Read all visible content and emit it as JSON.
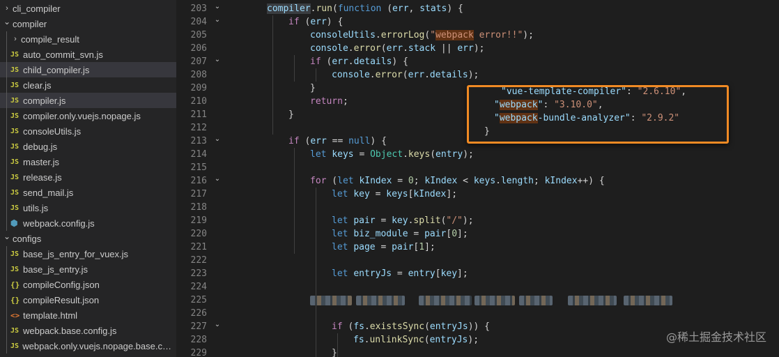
{
  "explorer": {
    "items": [
      {
        "label": "cli_compiler",
        "type": "folder",
        "level": 0,
        "expanded": false
      },
      {
        "label": "compiler",
        "type": "folder",
        "level": 0,
        "expanded": true
      },
      {
        "label": "compile_result",
        "type": "folder",
        "level": 1,
        "expanded": false
      },
      {
        "label": "auto_commit_svn.js",
        "type": "js",
        "level": 1
      },
      {
        "label": "child_compiler.js",
        "type": "js",
        "level": 1,
        "selected": true
      },
      {
        "label": "clear.js",
        "type": "js",
        "level": 1
      },
      {
        "label": "compiler.js",
        "type": "js",
        "level": 1,
        "hover": true
      },
      {
        "label": "compiler.only.vuejs.nopage.js",
        "type": "js",
        "level": 1
      },
      {
        "label": "consoleUtils.js",
        "type": "js",
        "level": 1
      },
      {
        "label": "debug.js",
        "type": "js",
        "level": 1
      },
      {
        "label": "master.js",
        "type": "js",
        "level": 1
      },
      {
        "label": "release.js",
        "type": "js",
        "level": 1
      },
      {
        "label": "send_mail.js",
        "type": "js",
        "level": 1
      },
      {
        "label": "utils.js",
        "type": "js",
        "level": 1
      },
      {
        "label": "webpack.config.js",
        "type": "webpack",
        "level": 1
      },
      {
        "label": "configs",
        "type": "folder",
        "level": 0,
        "expanded": true
      },
      {
        "label": "base_js_entry_for_vuex.js",
        "type": "js",
        "level": 1
      },
      {
        "label": "base_js_entry.js",
        "type": "js",
        "level": 1
      },
      {
        "label": "compileConfig.json",
        "type": "json",
        "level": 1
      },
      {
        "label": "compileResult.json",
        "type": "json",
        "level": 1
      },
      {
        "label": "template.html",
        "type": "html",
        "level": 1
      },
      {
        "label": "webpack.base.config.js",
        "type": "js",
        "level": 1
      },
      {
        "label": "webpack.only.vuejs.nopage.base.conf...",
        "type": "js",
        "level": 1
      }
    ],
    "icons": {
      "js": "JS",
      "json": "{}",
      "html": "<>",
      "webpack": "⬢",
      "folder_collapsed": "›",
      "folder_expanded": "⌄"
    }
  },
  "editor": {
    "lines": [
      {
        "n": "203",
        "fold": true,
        "indent": 2,
        "tokens": [
          [
            "compiler",
            "fnvarhl"
          ],
          [
            ".",
            ""
          ],
          [
            "run",
            "fn"
          ],
          [
            "(",
            ""
          ],
          [
            "function",
            "kw"
          ],
          [
            " (",
            ""
          ],
          [
            "err",
            "var"
          ],
          [
            ", ",
            ""
          ],
          [
            "stats",
            "var"
          ],
          [
            ") {",
            ""
          ]
        ]
      },
      {
        "n": "204",
        "fold": true,
        "indent": 3,
        "tokens": [
          [
            "if",
            "ctl"
          ],
          [
            " (",
            ""
          ],
          [
            "err",
            "var"
          ],
          [
            ") {",
            ""
          ]
        ]
      },
      {
        "n": "205",
        "fold": false,
        "indent": 4,
        "tokens": [
          [
            "consoleUtils",
            "var"
          ],
          [
            ".",
            ""
          ],
          [
            "errorLog",
            "fn"
          ],
          [
            "(",
            ""
          ],
          [
            "\"",
            "str"
          ],
          [
            "webpack",
            "strhl"
          ],
          [
            " error!!\"",
            "str"
          ],
          [
            ");",
            ""
          ]
        ]
      },
      {
        "n": "206",
        "fold": false,
        "indent": 4,
        "tokens": [
          [
            "console",
            "var"
          ],
          [
            ".",
            ""
          ],
          [
            "error",
            "fn"
          ],
          [
            "(",
            ""
          ],
          [
            "err",
            "var"
          ],
          [
            ".",
            ""
          ],
          [
            "stack",
            "var"
          ],
          [
            " || ",
            ""
          ],
          [
            "err",
            "var"
          ],
          [
            ");",
            ""
          ]
        ]
      },
      {
        "n": "207",
        "fold": true,
        "indent": 4,
        "tokens": [
          [
            "if",
            "ctl"
          ],
          [
            " (",
            ""
          ],
          [
            "err",
            "var"
          ],
          [
            ".",
            ""
          ],
          [
            "details",
            "var"
          ],
          [
            ") {",
            ""
          ]
        ]
      },
      {
        "n": "208",
        "fold": false,
        "indent": 5,
        "tokens": [
          [
            "console",
            "var"
          ],
          [
            ".",
            ""
          ],
          [
            "error",
            "fn"
          ],
          [
            "(",
            ""
          ],
          [
            "err",
            "var"
          ],
          [
            ".",
            ""
          ],
          [
            "details",
            "var"
          ],
          [
            ");",
            ""
          ]
        ]
      },
      {
        "n": "209",
        "fold": false,
        "indent": 4,
        "tokens": [
          [
            "}",
            ""
          ]
        ]
      },
      {
        "n": "210",
        "fold": false,
        "indent": 4,
        "tokens": [
          [
            "return",
            "ctl"
          ],
          [
            ";",
            ""
          ]
        ]
      },
      {
        "n": "211",
        "fold": false,
        "indent": 3,
        "tokens": [
          [
            "}",
            ""
          ]
        ]
      },
      {
        "n": "212",
        "fold": false,
        "indent": 0,
        "tokens": []
      },
      {
        "n": "213",
        "fold": true,
        "indent": 3,
        "tokens": [
          [
            "if",
            "ctl"
          ],
          [
            " (",
            ""
          ],
          [
            "err",
            "var"
          ],
          [
            " == ",
            ""
          ],
          [
            "null",
            "kw"
          ],
          [
            ") {",
            ""
          ]
        ]
      },
      {
        "n": "214",
        "fold": false,
        "indent": 4,
        "tokens": [
          [
            "let",
            "kw"
          ],
          [
            " ",
            ""
          ],
          [
            "keys",
            "var"
          ],
          [
            " = ",
            ""
          ],
          [
            "Object",
            "cls"
          ],
          [
            ".",
            ""
          ],
          [
            "keys",
            "fn"
          ],
          [
            "(",
            ""
          ],
          [
            "entry",
            "var"
          ],
          [
            ");",
            ""
          ]
        ]
      },
      {
        "n": "215",
        "fold": false,
        "indent": 0,
        "tokens": []
      },
      {
        "n": "216",
        "fold": true,
        "indent": 4,
        "tokens": [
          [
            "for",
            "ctl"
          ],
          [
            " (",
            ""
          ],
          [
            "let",
            "kw"
          ],
          [
            " ",
            ""
          ],
          [
            "kIndex",
            "var"
          ],
          [
            " = ",
            ""
          ],
          [
            "0",
            "num"
          ],
          [
            "; ",
            ""
          ],
          [
            "kIndex",
            "var"
          ],
          [
            " < ",
            ""
          ],
          [
            "keys",
            "var"
          ],
          [
            ".",
            ""
          ],
          [
            "length",
            "var"
          ],
          [
            "; ",
            ""
          ],
          [
            "kIndex",
            "var"
          ],
          [
            "++) {",
            ""
          ]
        ]
      },
      {
        "n": "217",
        "fold": false,
        "indent": 5,
        "tokens": [
          [
            "let",
            "kw"
          ],
          [
            " ",
            ""
          ],
          [
            "key",
            "var"
          ],
          [
            " = ",
            ""
          ],
          [
            "keys",
            "var"
          ],
          [
            "[",
            ""
          ],
          [
            "kIndex",
            "var"
          ],
          [
            "];",
            ""
          ]
        ]
      },
      {
        "n": "218",
        "fold": false,
        "indent": 0,
        "tokens": []
      },
      {
        "n": "219",
        "fold": false,
        "indent": 5,
        "tokens": [
          [
            "let",
            "kw"
          ],
          [
            " ",
            ""
          ],
          [
            "pair",
            "var"
          ],
          [
            " = ",
            ""
          ],
          [
            "key",
            "var"
          ],
          [
            ".",
            ""
          ],
          [
            "split",
            "fn"
          ],
          [
            "(",
            ""
          ],
          [
            "\"/\"",
            "str"
          ],
          [
            ");",
            ""
          ]
        ]
      },
      {
        "n": "220",
        "fold": false,
        "indent": 5,
        "tokens": [
          [
            "let",
            "kw"
          ],
          [
            " ",
            ""
          ],
          [
            "biz_module",
            "var"
          ],
          [
            " = ",
            ""
          ],
          [
            "pair",
            "var"
          ],
          [
            "[",
            ""
          ],
          [
            "0",
            "num"
          ],
          [
            "];",
            ""
          ]
        ]
      },
      {
        "n": "221",
        "fold": false,
        "indent": 5,
        "tokens": [
          [
            "let",
            "kw"
          ],
          [
            " ",
            ""
          ],
          [
            "page",
            "var"
          ],
          [
            " = ",
            ""
          ],
          [
            "pair",
            "var"
          ],
          [
            "[",
            ""
          ],
          [
            "1",
            "num"
          ],
          [
            "];",
            ""
          ]
        ]
      },
      {
        "n": "222",
        "fold": false,
        "indent": 0,
        "tokens": []
      },
      {
        "n": "223",
        "fold": false,
        "indent": 5,
        "tokens": [
          [
            "let",
            "kw"
          ],
          [
            " ",
            ""
          ],
          [
            "entryJs",
            "var"
          ],
          [
            " = ",
            ""
          ],
          [
            "entry",
            "var"
          ],
          [
            "[",
            ""
          ],
          [
            "key",
            "var"
          ],
          [
            "];",
            ""
          ]
        ]
      },
      {
        "n": "224",
        "fold": false,
        "indent": 0,
        "tokens": []
      },
      {
        "n": "225",
        "fold": false,
        "indent": 5,
        "tokens": [],
        "blurred": true
      },
      {
        "n": "226",
        "fold": false,
        "indent": 0,
        "tokens": []
      },
      {
        "n": "227",
        "fold": true,
        "indent": 5,
        "tokens": [
          [
            "if",
            "ctl"
          ],
          [
            " (",
            ""
          ],
          [
            "fs",
            "var"
          ],
          [
            ".",
            ""
          ],
          [
            "existsSync",
            "fn"
          ],
          [
            "(",
            ""
          ],
          [
            "entryJs",
            "var"
          ],
          [
            ")) {",
            ""
          ]
        ]
      },
      {
        "n": "228",
        "fold": false,
        "indent": 6,
        "tokens": [
          [
            "fs",
            "var"
          ],
          [
            ".",
            ""
          ],
          [
            "unlinkSync",
            "fn"
          ],
          [
            "(",
            ""
          ],
          [
            "entryJs",
            "var"
          ],
          [
            ");",
            ""
          ]
        ]
      },
      {
        "n": "229",
        "fold": false,
        "indent": 5,
        "tokens": [
          [
            "}",
            ""
          ]
        ]
      }
    ]
  },
  "overlay": {
    "lines": [
      {
        "tokens": [
          [
            "\"vue-template-compiler\"",
            "okey"
          ],
          [
            ": ",
            ""
          ],
          [
            "\"2.6.10\"",
            "str"
          ],
          [
            ",",
            ""
          ]
        ]
      },
      {
        "tokens": [
          [
            "\"",
            "okey"
          ],
          [
            "webpack",
            "okeyhl"
          ],
          [
            "\"",
            "okey"
          ],
          [
            ": ",
            ""
          ],
          [
            "\"3.10.0\"",
            "str"
          ],
          [
            ",",
            ""
          ]
        ]
      },
      {
        "tokens": [
          [
            "\"",
            "okey"
          ],
          [
            "webpack",
            "okeyhl"
          ],
          [
            "-bundle-analyzer\"",
            "okey"
          ],
          [
            ": ",
            ""
          ],
          [
            "\"2.9.2\"",
            "str"
          ]
        ]
      },
      {
        "tokens": [
          [
            "}",
            ""
          ]
        ]
      }
    ],
    "border_color": "#f08a24"
  },
  "watermark": "@稀土掘金技术社区"
}
